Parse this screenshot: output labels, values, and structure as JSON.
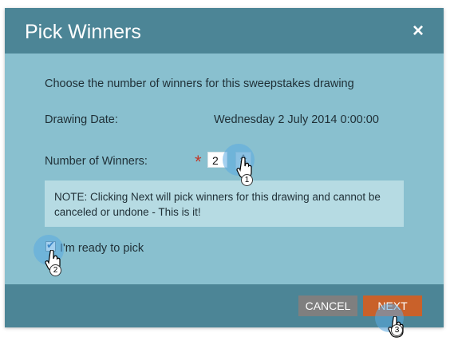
{
  "dialog": {
    "title": "Pick Winners",
    "close_icon": "×",
    "intro": "Choose the number of winners for this sweepstakes drawing",
    "drawing_date_label": "Drawing Date:",
    "drawing_date_value": "Wednesday 2 July 2014 0:00:00",
    "winners_label": "Number of Winners:",
    "required_marker": "*",
    "winners_value": "2",
    "note": "NOTE:  Clicking Next will pick winners for this drawing and cannot be canceled or undone - This is it!",
    "ready_label": "I'm ready to pick",
    "ready_checked": true
  },
  "buttons": {
    "cancel": "CANCEL",
    "next": "NEXT"
  },
  "annotations": {
    "step1": "1",
    "step2": "2",
    "step3": "3"
  },
  "colors": {
    "header": "#4c8596",
    "body": "#89c0cf",
    "note_bg": "#b6dbe3",
    "next_button": "#c9612a",
    "cancel_button": "#7f7f7f"
  }
}
